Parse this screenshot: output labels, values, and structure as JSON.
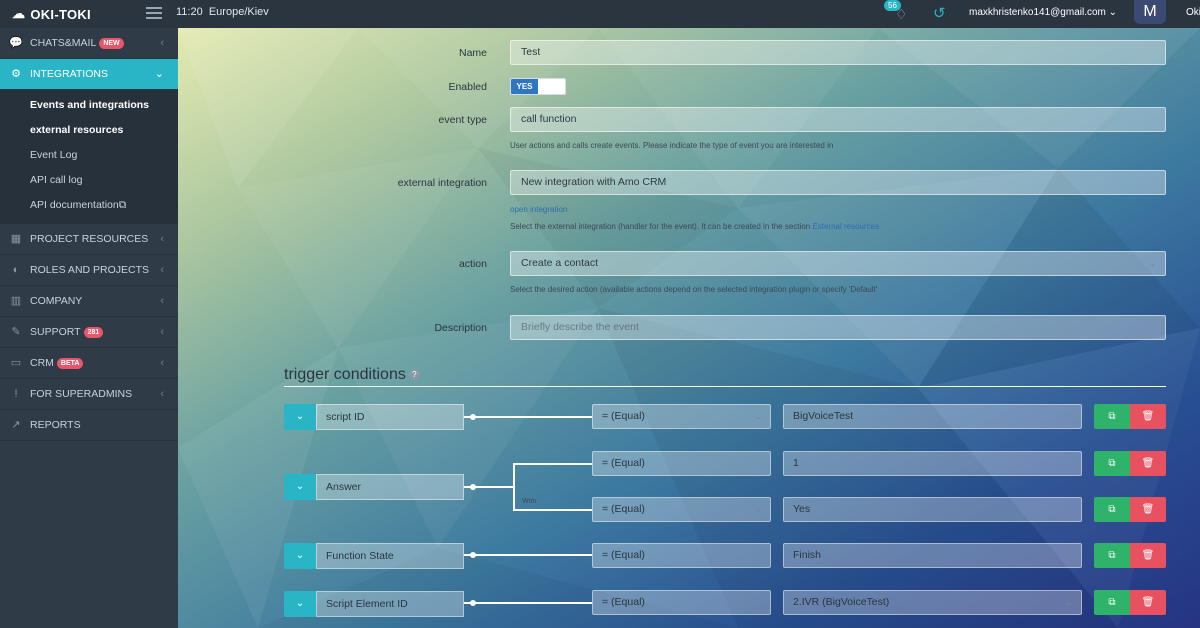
{
  "topbar": {
    "logo": "OKI-TOKI",
    "time": "11:20",
    "timezone": "Europe/Kiev",
    "notifications_count": "56",
    "email": "maxkhristenko141@gmail.com",
    "avatar_letter": "M",
    "cut_text": "Oki"
  },
  "sidebar": {
    "items": [
      {
        "label": "CHATS&MAIL",
        "badge": "NEW",
        "icon": "chat-icon"
      },
      {
        "label": "INTEGRATIONS",
        "icon": "gears-icon"
      },
      {
        "label": "PROJECT RESOURCES",
        "icon": "grid-icon"
      },
      {
        "label": "ROLES AND PROJECTS",
        "icon": "toggle-icon"
      },
      {
        "label": "COMPANY",
        "icon": "bar-chart-icon"
      },
      {
        "label": "SUPPORT",
        "badge": "281",
        "icon": "wrench-icon"
      },
      {
        "label": "CRM",
        "badge": "BETA",
        "icon": "card-icon"
      },
      {
        "label": "FOR SUPERADMINS",
        "icon": "exclamation-icon"
      },
      {
        "label": "REPORTS",
        "icon": "line-chart-icon"
      }
    ],
    "sub": [
      "Events and integrations",
      "external resources",
      "Event Log",
      "API call log",
      "API documentation"
    ]
  },
  "form": {
    "name_label": "Name",
    "name_value": "Test",
    "enabled_label": "Enabled",
    "enabled_toggle": "YES",
    "event_type_label": "event type",
    "event_type_value": "call function",
    "event_type_hint": "User actions and calls create events. Please indicate the type of event you are interested in",
    "ext_label": "external integration",
    "ext_value": "New integration with Amo CRM",
    "ext_link": "open integration",
    "ext_hint": "Select the external integration (handler for the event). It can be created in the section",
    "ext_hint_link": "External resources",
    "action_label": "action",
    "action_value": "Create a contact",
    "action_hint": "Select the desired action (available actions depend on the selected integration plugin or specify 'Default'",
    "desc_label": "Description",
    "desc_placeholder": "Briefly describe the event"
  },
  "triggers": {
    "title": "trigger conditions",
    "when_label": "Wrin",
    "rows": [
      {
        "name": "script ID",
        "op": "= (Equal)",
        "value": "BigVoiceTest"
      },
      {
        "name": "Answer",
        "op": "= (Equal)",
        "value": "1"
      },
      {
        "name": "",
        "op": "= (Equal)",
        "value": "Yes"
      },
      {
        "name": "Function State",
        "op": "= (Equal)",
        "value": "Finish"
      },
      {
        "name": "Script Element ID",
        "op": "= (Equal)",
        "value": "2.IVR (BigVoiceTest)"
      }
    ]
  }
}
